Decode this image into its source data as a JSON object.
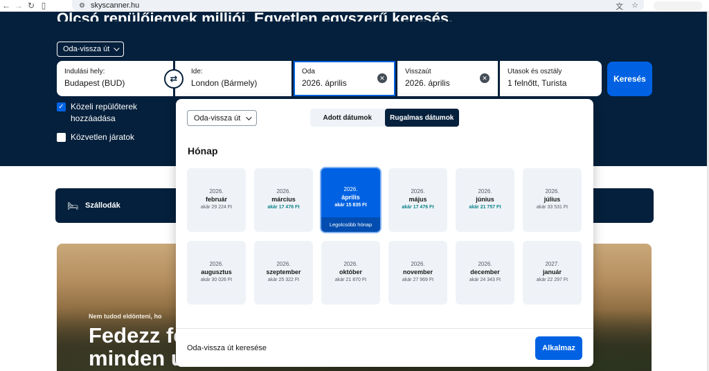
{
  "browser": {
    "url": "skyscanner.hu",
    "icons": {
      "back": "back-arrow-icon",
      "forward": "forward-arrow-icon",
      "reload": "reload-icon",
      "sidebar": "sidebar-icon",
      "site": "site-settings-icon",
      "translate": "translate-icon",
      "bookmark": "star-icon"
    }
  },
  "hero": {
    "title": "Olcsó repülőjegyek milliói. Egyetlen egyszerű keresés.",
    "trip_type": "Oda-vissza út",
    "from": {
      "label": "Indulási hely:",
      "value": "Budapest (BUD)"
    },
    "to": {
      "label": "Ide:",
      "value": "London (Bármely)"
    },
    "depart": {
      "label": "Oda",
      "value": "2026. április"
    },
    "return": {
      "label": "Visszaút",
      "value": "2026. április"
    },
    "passengers": {
      "label": "Utasok és osztály",
      "value": "1 felnőtt, Turista"
    },
    "search_button": "Keresés",
    "nearby_airports": {
      "label": "Közeli repülőterek hozzáadása",
      "checked": true
    },
    "direct_flights": {
      "label": "Közvetlen járatok",
      "checked": false
    }
  },
  "hotels": {
    "label": "Szállodák"
  },
  "banner": {
    "small": "Nem tudod eldönteni, ho",
    "big_line1": "Fedezz fe",
    "big_line2": "minden út"
  },
  "popup": {
    "trip_type": "Oda-vissza út",
    "tabs": [
      "Adott dátumok",
      "Rugalmas dátumok"
    ],
    "active_tab": 1,
    "heading": "Hónap",
    "months": [
      {
        "year": "2026.",
        "month": "február",
        "price": "akár 29 224 Ft",
        "cheap": false
      },
      {
        "year": "2026.",
        "month": "március",
        "price": "akár 17 476 Ft",
        "cheap": true
      },
      {
        "year": "2026.",
        "month": "április",
        "price": "akár 15 835 Ft",
        "cheap": true,
        "selected": true,
        "tag": "Legolcsóbb hónap"
      },
      {
        "year": "2026.",
        "month": "május",
        "price": "akár 17 476 Ft",
        "cheap": true
      },
      {
        "year": "2026.",
        "month": "június",
        "price": "akár 21 757 Ft",
        "cheap": true
      },
      {
        "year": "2026.",
        "month": "július",
        "price": "akár 33 531 Ft",
        "cheap": false
      },
      {
        "year": "2026.",
        "month": "augusztus",
        "price": "akár 30 026 Ft",
        "cheap": false
      },
      {
        "year": "2026.",
        "month": "szeptember",
        "price": "akár 25 322 Ft",
        "cheap": false
      },
      {
        "year": "2026.",
        "month": "október",
        "price": "akár 21 870 Ft",
        "cheap": false
      },
      {
        "year": "2026.",
        "month": "november",
        "price": "akár 27 969 Ft",
        "cheap": false
      },
      {
        "year": "2026.",
        "month": "december",
        "price": "akár 24 343 Ft",
        "cheap": false
      },
      {
        "year": "2027.",
        "month": "január",
        "price": "akár 22 297 Ft",
        "cheap": false
      }
    ],
    "footer_text": "Oda-vissza út keresése",
    "apply_button": "Alkalmaz"
  },
  "colors": {
    "navy": "#05203c",
    "primary": "#0062e3",
    "cheap_price": "#0c838a",
    "card_bg": "#eff3f8"
  }
}
